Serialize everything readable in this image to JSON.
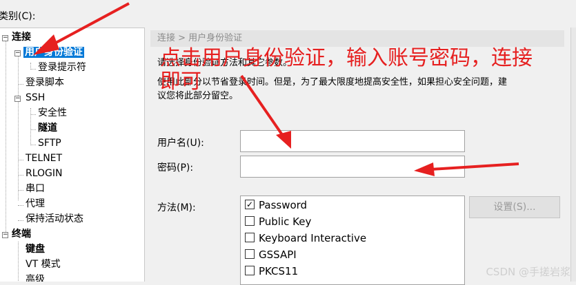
{
  "category": {
    "label": "类别(C):",
    "shortcut": "C"
  },
  "tree": {
    "items": [
      {
        "label": "连接"
      },
      {
        "label": "用户身份验证"
      },
      {
        "label": "登录提示符"
      },
      {
        "label": "登录脚本"
      },
      {
        "label": "SSH"
      },
      {
        "label": "安全性"
      },
      {
        "label": "隧道"
      },
      {
        "label": "SFTP"
      },
      {
        "label": "TELNET"
      },
      {
        "label": "RLOGIN"
      },
      {
        "label": "串口"
      },
      {
        "label": "代理"
      },
      {
        "label": "保持活动状态"
      },
      {
        "label": "终端"
      },
      {
        "label": "键盘"
      },
      {
        "label": "VT 模式"
      },
      {
        "label": "高级"
      }
    ]
  },
  "panel": {
    "breadcrumb": "连接 > 用户身份验证",
    "desc_line1": "请选择身份验证方法和其它参数。",
    "desc_line2": "使用此部分以节省登录时间。但是，为了最大限度地提高安全性，如果担心安全问题，建",
    "desc_line3": "议您将此部分留空。",
    "username_label": "用户名(U):",
    "username_value": "",
    "password_label": "密码(P):",
    "password_value": "",
    "method_label": "方法(M):",
    "methods": [
      {
        "label": "Password",
        "checked": true
      },
      {
        "label": "Public Key",
        "checked": false
      },
      {
        "label": "Keyboard Interactive",
        "checked": false
      },
      {
        "label": "GSSAPI",
        "checked": false
      },
      {
        "label": "PKCS11",
        "checked": false
      }
    ],
    "settings_button": "设置(S)...",
    "check_mark": "✓"
  },
  "annotation": {
    "line1": "点击用户身份验证，输入账号密码，连接",
    "line2": "即可",
    "color": "#e62020"
  },
  "watermark": "CSDN @手搓岩浆"
}
